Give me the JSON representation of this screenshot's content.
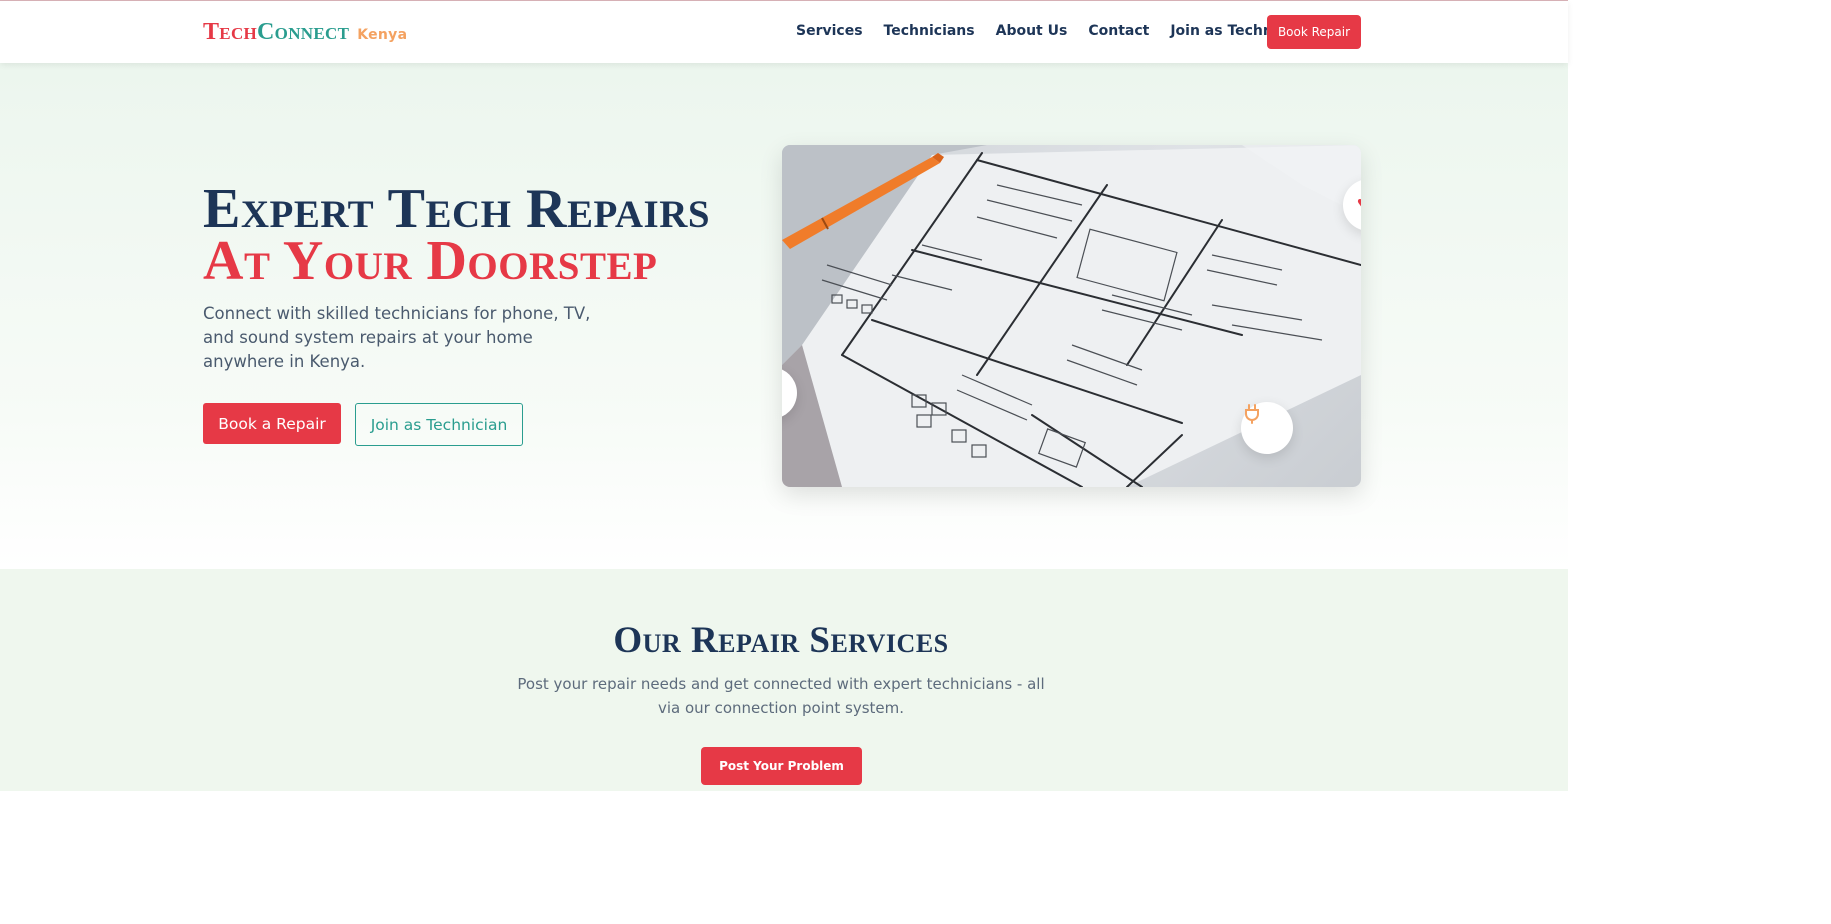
{
  "brand": {
    "name_part1": "Tech",
    "name_part2": "Connect",
    "region": "Kenya"
  },
  "nav": {
    "items": [
      {
        "label": "Services"
      },
      {
        "label": "Technicians"
      },
      {
        "label": "About Us"
      },
      {
        "label": "Contact"
      },
      {
        "label": "Join as Technician"
      }
    ],
    "cta_label": "Book Repair"
  },
  "hero": {
    "title_line1": "Expert Tech Repairs",
    "title_line2": "At Your Doorstep",
    "subtitle": "Connect with skilled technicians for phone, TV, and sound system repairs at your home anywhere in Kenya.",
    "primary_button": "Book a Repair",
    "secondary_button": "Join as Technician",
    "floating_icons": [
      "plug-icon",
      "heart-icon",
      "wrench-icon"
    ]
  },
  "services": {
    "title": "Our Repair Services",
    "subtitle": "Post your repair needs and get connected with expert technicians - all via our connection point system.",
    "button": "Post Your Problem"
  },
  "colors": {
    "primary_red": "#e63946",
    "navy": "#1d3557",
    "teal": "#2a9d8f",
    "orange": "#f4a261"
  }
}
